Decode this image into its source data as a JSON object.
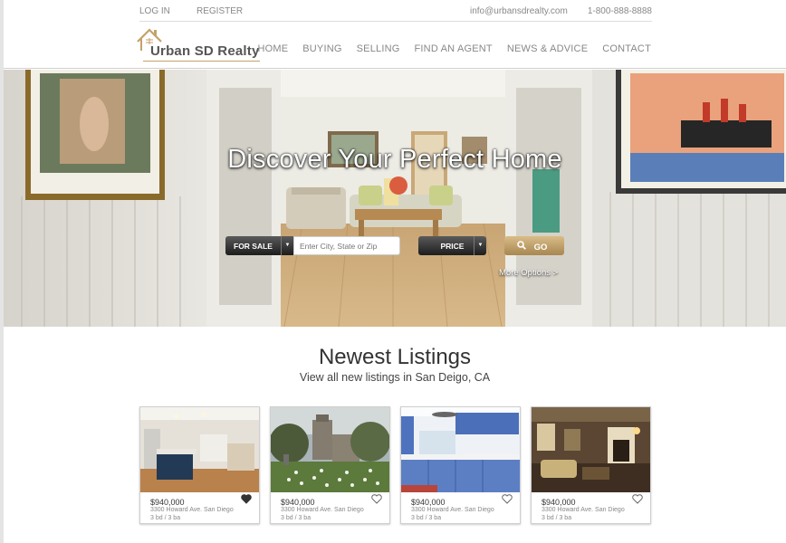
{
  "topbar": {
    "login": "LOG IN",
    "register": "REGISTER",
    "email": "info@urbansdrealty.com",
    "phone": "1-800-888-8888"
  },
  "logo": {
    "text": "Urban SD Realty",
    "accent": "#c4a26a"
  },
  "nav": [
    "HOME",
    "BUYING",
    "SELLING",
    "FIND AN AGENT",
    "NEWS & ADVICE",
    "CONTACT"
  ],
  "hero": {
    "title": "Discover Your Perfect Home",
    "sale_select": "FOR SALE",
    "search_placeholder": "Enter City, State or Zip",
    "price_select": "PRICE",
    "go_label": "GO",
    "more_options": "More Options >"
  },
  "listings": {
    "title": "Newest Listings",
    "subtitle": "View all new listings in San Deigo, CA",
    "cards": [
      {
        "price": "$940,000",
        "address": "3300 Howard Ave. San Diego",
        "beds": "3 bd / 3 ba",
        "favorited": true,
        "image": "kitchen-interior"
      },
      {
        "price": "$940,000",
        "address": "3300 Howard Ave. San Diego",
        "beds": "3 bd / 3 ba",
        "favorited": false,
        "image": "church-garden"
      },
      {
        "price": "$940,000",
        "address": "3300 Howard Ave. San Diego",
        "beds": "3 bd / 3 ba",
        "favorited": false,
        "image": "blue-kitchen"
      },
      {
        "price": "$940,000",
        "address": "3300 Howard Ave. San Diego",
        "beds": "3 bd / 3 ba",
        "favorited": false,
        "image": "living-room"
      }
    ]
  },
  "colors": {
    "gold": "#c4a26a",
    "dark_button": "#2a2a2a",
    "text": "#333333"
  }
}
